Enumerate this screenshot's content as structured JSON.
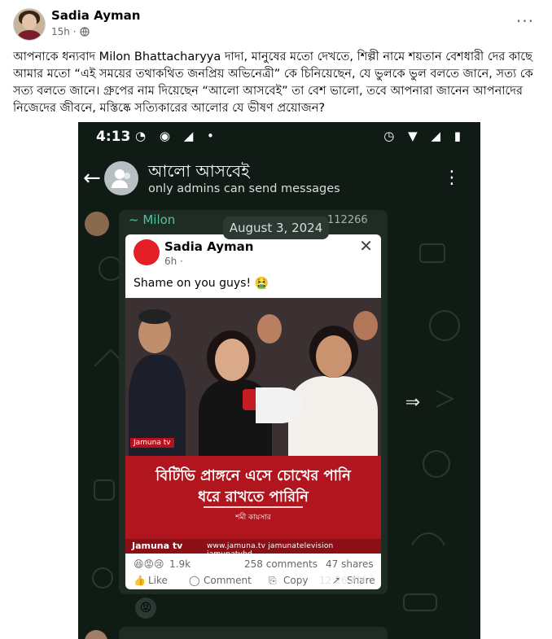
{
  "post": {
    "author": "Sadia Ayman",
    "time": "15h ·",
    "more": "···",
    "caption": "আপনাকে ধন্যবাদ Milon Bhattacharyya দাদা, মানুষের মতো দেখতে, শিল্পী নামে শয়তান বেশধারী দের কাছে আমার মতো “এই সময়ের তথাকথিত জনপ্রিয় অভিনেত্রী” কে চিনিয়েছেন, যে ভুলকে ভুল বলতে জানে, সত্য কে সত্য বলতে জানে। গ্রুপের নাম দিয়েছেন “আলো আসবেই” তা বেশ ভালো, তবে আপনারা জানেন আপনাদের নিজেদের জীবনে, মস্তিষ্কে সত্যিকারের আলোর যে ভীষণ প্রয়োজন?"
  },
  "screenshot": {
    "status_time": "4:13",
    "status_left_icons": "◔ ◉ ◢ •",
    "status_right_icons": "◷ ▼ ◢ ▮",
    "group_name": "আলো আসবেই",
    "group_sub": "only admins can send messages",
    "sender": "~ Milon",
    "sender_number": "112266",
    "date_pill": "August 3, 2024",
    "message_time": "12:26 AM",
    "card": {
      "author": "Sadia Ayman",
      "meta": "6h ·",
      "text": "Shame on you guys! 🤮",
      "banner_line1": "বিটিভি প্রাঙ্গনে এসে চোখের পানি",
      "banner_line2": "ধরে রাখতে পারিনি",
      "banner_credit": "শমী কায়সার",
      "logo": "Jamuna tv",
      "footer_brand": "Jamuna tv",
      "footer_links": "www.jamuna.tv  jamunatelevision  jamunatvbd",
      "reactions": "😆😡😢",
      "likes": "1.9k",
      "comments": "258 comments",
      "shares": "47 shares",
      "like_label": "Like",
      "comment_label": "Comment",
      "copy_label": "Copy",
      "share_label": "Share"
    },
    "emoji_reaction": "😡"
  }
}
